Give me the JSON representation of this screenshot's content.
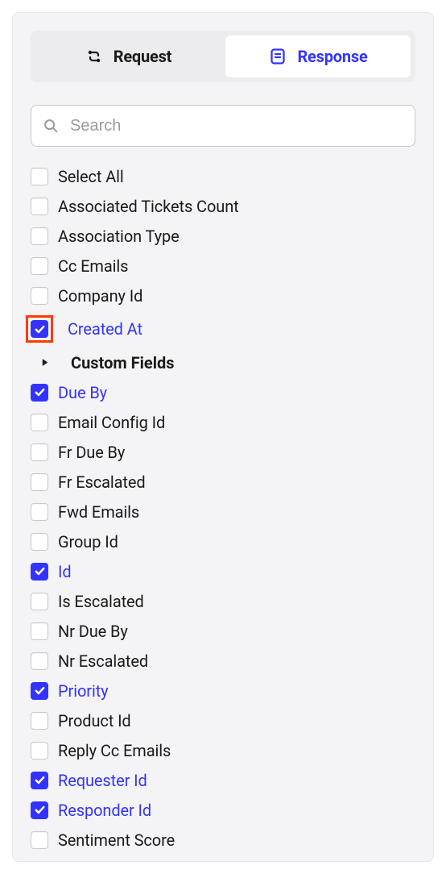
{
  "tabs": {
    "request": "Request",
    "response": "Response"
  },
  "search": {
    "placeholder": "Search",
    "value": ""
  },
  "fields": {
    "select_all": "Select All",
    "associated_tickets_count": "Associated Tickets Count",
    "association_type": "Association Type",
    "cc_emails": "Cc Emails",
    "company_id": "Company Id",
    "created_at": "Created At",
    "custom_fields": "Custom Fields",
    "due_by": "Due By",
    "email_config_id": "Email Config Id",
    "fr_due_by": "Fr Due By",
    "fr_escalated": "Fr Escalated",
    "fwd_emails": "Fwd Emails",
    "group_id": "Group Id",
    "id": "Id",
    "is_escalated": "Is Escalated",
    "nr_due_by": "Nr Due By",
    "nr_escalated": "Nr Escalated",
    "priority": "Priority",
    "product_id": "Product Id",
    "reply_cc_emails": "Reply Cc Emails",
    "requester_id": "Requester Id",
    "responder_id": "Responder Id",
    "sentiment_score": "Sentiment Score"
  },
  "checked": {
    "created_at": true,
    "due_by": true,
    "id": true,
    "priority": true,
    "requester_id": true,
    "responder_id": true
  },
  "highlighted": "created_at",
  "colors": {
    "accent": "#3333ff",
    "highlight": "#ff3b00"
  }
}
